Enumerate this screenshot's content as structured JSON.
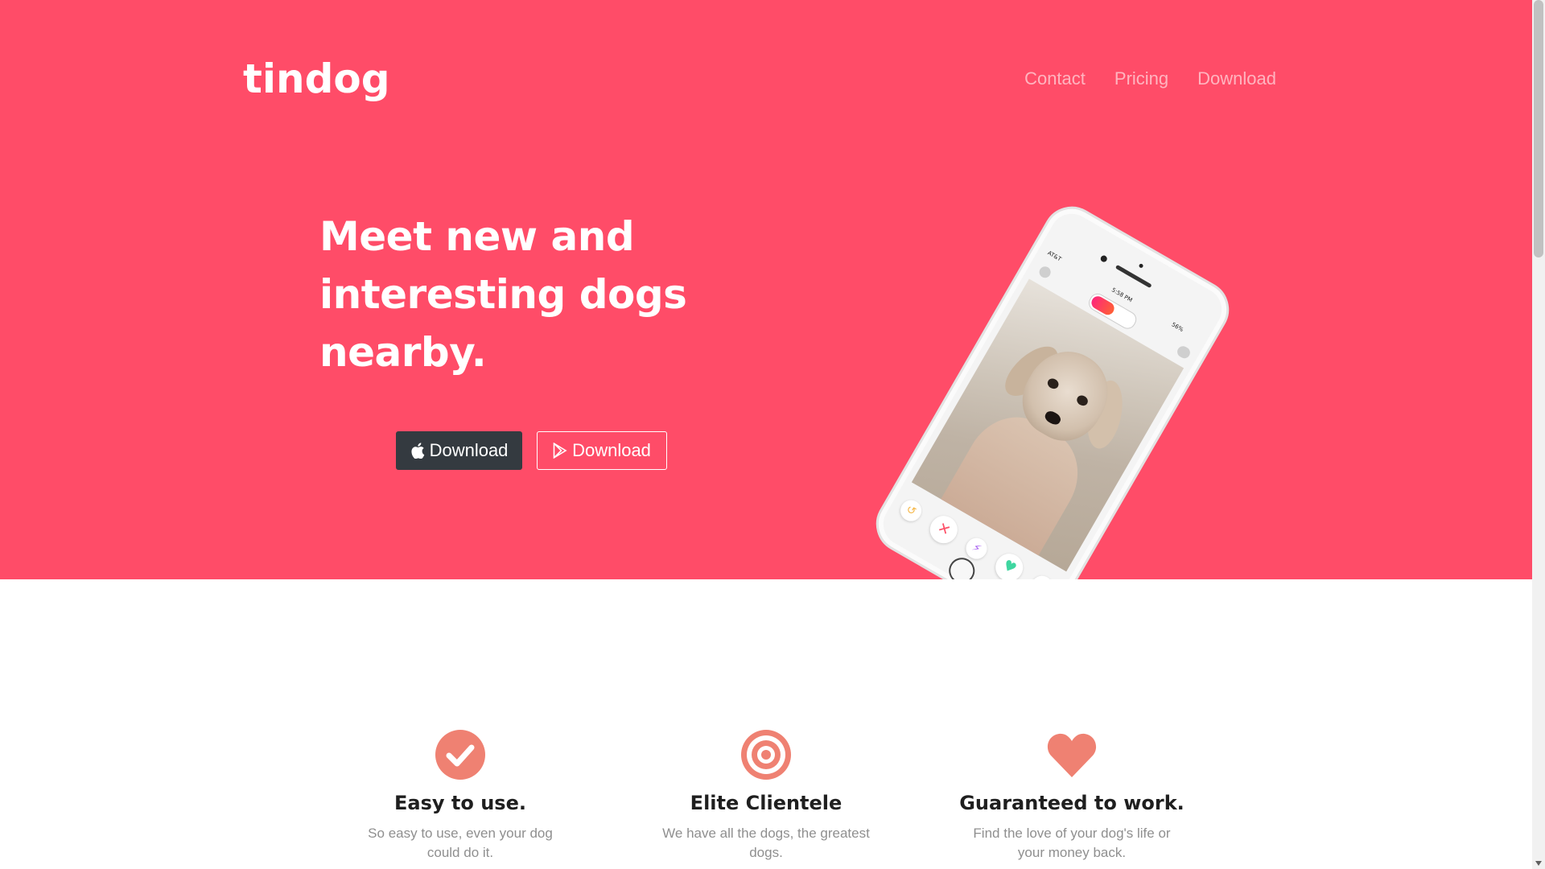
{
  "header": {
    "brand": "tindog",
    "nav": [
      {
        "label": "Contact"
      },
      {
        "label": "Pricing"
      },
      {
        "label": "Download"
      }
    ]
  },
  "hero": {
    "headline": "Meet new and interesting dogs nearby.",
    "buttons": {
      "apple": {
        "label": "Download",
        "icon": "apple-icon"
      },
      "google_play": {
        "label": "Download",
        "icon": "play-icon"
      }
    },
    "phone_status": {
      "carrier": "AT&T",
      "time": "5:58 PM",
      "battery": "56%"
    }
  },
  "features": [
    {
      "icon": "check-circle-icon",
      "title": "Easy to use.",
      "text": "So easy to use, even your dog could do it."
    },
    {
      "icon": "target-icon",
      "title": "Elite Clientele",
      "text": "We have all the dogs, the greatest dogs."
    },
    {
      "icon": "heart-icon",
      "title": "Guaranteed to work.",
      "text": "Find the love of your dog's life or your money back."
    }
  ],
  "colors": {
    "hero_background": "#ff4c68",
    "icon_accent": "#ef8172",
    "dark_button": "#343a40"
  }
}
